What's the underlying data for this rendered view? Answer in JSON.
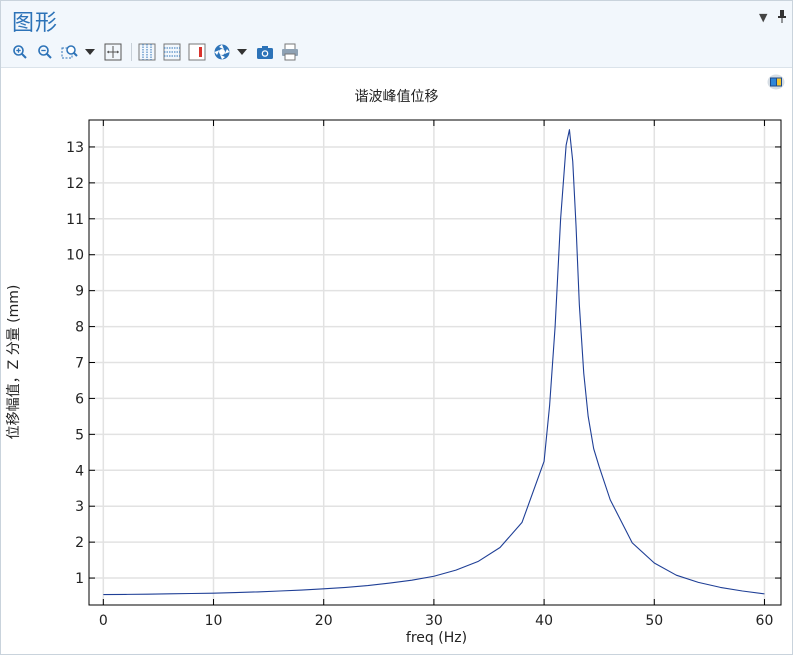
{
  "window": {
    "title": "图形"
  },
  "toolbar": {
    "buttons": [
      {
        "name": "zoom-in-icon"
      },
      {
        "name": "zoom-out-icon"
      },
      {
        "name": "zoom-box-icon"
      },
      {
        "name": "zoom-dropdown-chevron-icon"
      },
      {
        "name": "zoom-extents-icon"
      },
      {
        "name": "grid-vertical-icon"
      },
      {
        "name": "grid-horizontal-icon"
      },
      {
        "name": "legend-toggle-icon"
      },
      {
        "name": "color-scheme-icon"
      },
      {
        "name": "color-dropdown-chevron-icon"
      },
      {
        "name": "camera-icon"
      },
      {
        "name": "print-icon"
      }
    ]
  },
  "colors": {
    "accent": "#2d73b8",
    "series": "#1f3f96",
    "grid": "#e2e2e2"
  },
  "chart_data": {
    "type": "line",
    "title": "谐波峰值位移",
    "xlabel": "freq (Hz)",
    "ylabel": "位移幅值，Z 分量 (mm)",
    "xlim": [
      -1.3,
      61.5
    ],
    "ylim": [
      0.25,
      13.75
    ],
    "xticks": [
      0,
      10,
      20,
      30,
      40,
      50,
      60
    ],
    "yticks": [
      1,
      2,
      3,
      4,
      5,
      6,
      7,
      8,
      9,
      10,
      11,
      12,
      13
    ],
    "grid": true,
    "series": [
      {
        "x": [
          0,
          2,
          4,
          6,
          8,
          10,
          12,
          14,
          16,
          18,
          20,
          22,
          24,
          26,
          28,
          30,
          32,
          34,
          36,
          38,
          40,
          40.5,
          41,
          41.5,
          42,
          42.3,
          42.6,
          42.9,
          43.2,
          43.6,
          44,
          44.5,
          45,
          46,
          48,
          50,
          52,
          54,
          56,
          58,
          60
        ],
        "y": [
          0.54,
          0.545,
          0.55,
          0.56,
          0.57,
          0.58,
          0.595,
          0.615,
          0.64,
          0.665,
          0.7,
          0.74,
          0.79,
          0.86,
          0.94,
          1.05,
          1.22,
          1.46,
          1.85,
          2.55,
          4.25,
          5.8,
          8.0,
          11.0,
          13.05,
          13.48,
          12.6,
          10.8,
          8.6,
          6.7,
          5.5,
          4.6,
          4.1,
          3.18,
          1.98,
          1.42,
          1.08,
          0.88,
          0.74,
          0.64,
          0.56
        ]
      }
    ]
  }
}
